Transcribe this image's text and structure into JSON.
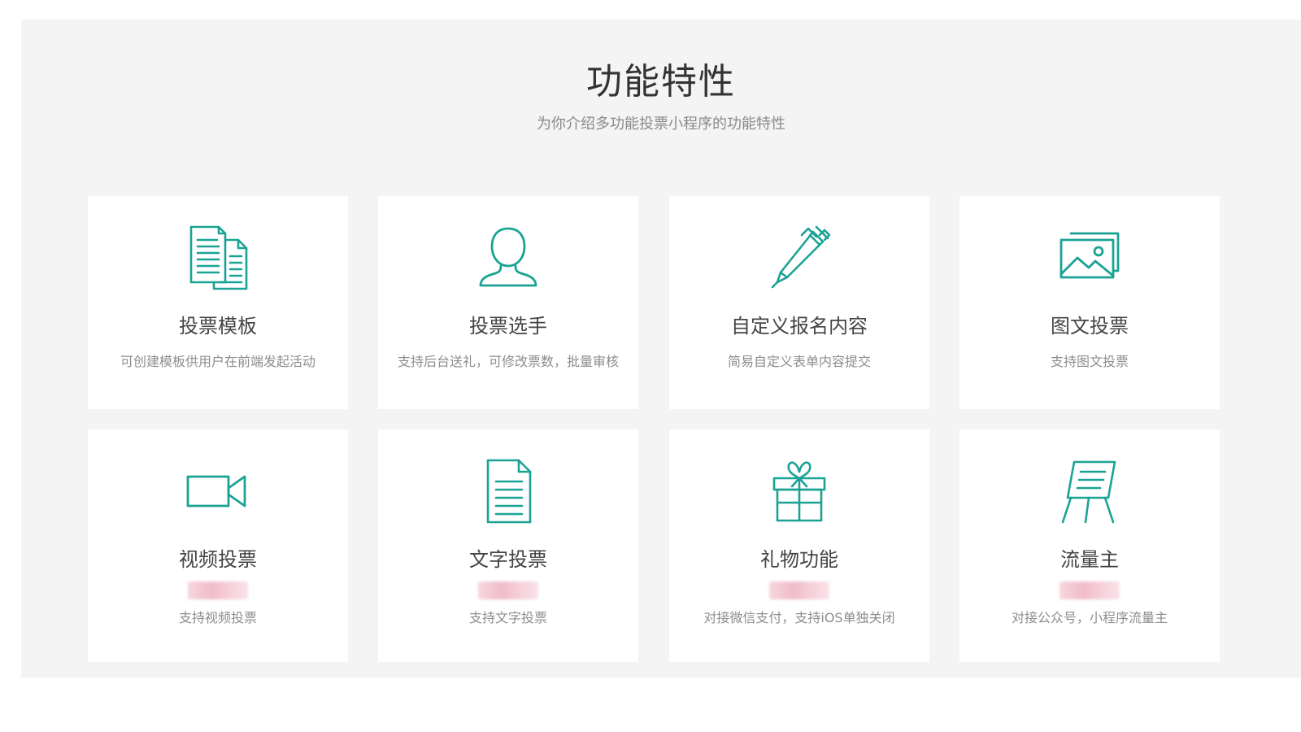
{
  "header": {
    "title": "功能特性",
    "subtitle": "为你介绍多功能投票小程序的功能特性"
  },
  "accent_color": "#1aa394",
  "features": [
    {
      "icon": "documents-icon",
      "title": "投票模板",
      "desc": "可创建模板供用户在前端发起活动"
    },
    {
      "icon": "user-icon",
      "title": "投票选手",
      "desc": "支持后台送礼，可修改票数，批量审核"
    },
    {
      "icon": "pen-icon",
      "title": "自定义报名内容",
      "desc": "简易自定义表单内容提交"
    },
    {
      "icon": "image-icon",
      "title": "图文投票",
      "desc": "支持图文投票"
    },
    {
      "icon": "video-camera-icon",
      "title": "视频投票",
      "desc": "支持视频投票"
    },
    {
      "icon": "document-icon",
      "title": "文字投票",
      "desc": "支持文字投票"
    },
    {
      "icon": "gift-icon",
      "title": "礼物功能",
      "desc": "对接微信支付，支持iOS单独关闭"
    },
    {
      "icon": "easel-icon",
      "title": "流量主",
      "desc": "对接公众号，小程序流量主"
    }
  ]
}
